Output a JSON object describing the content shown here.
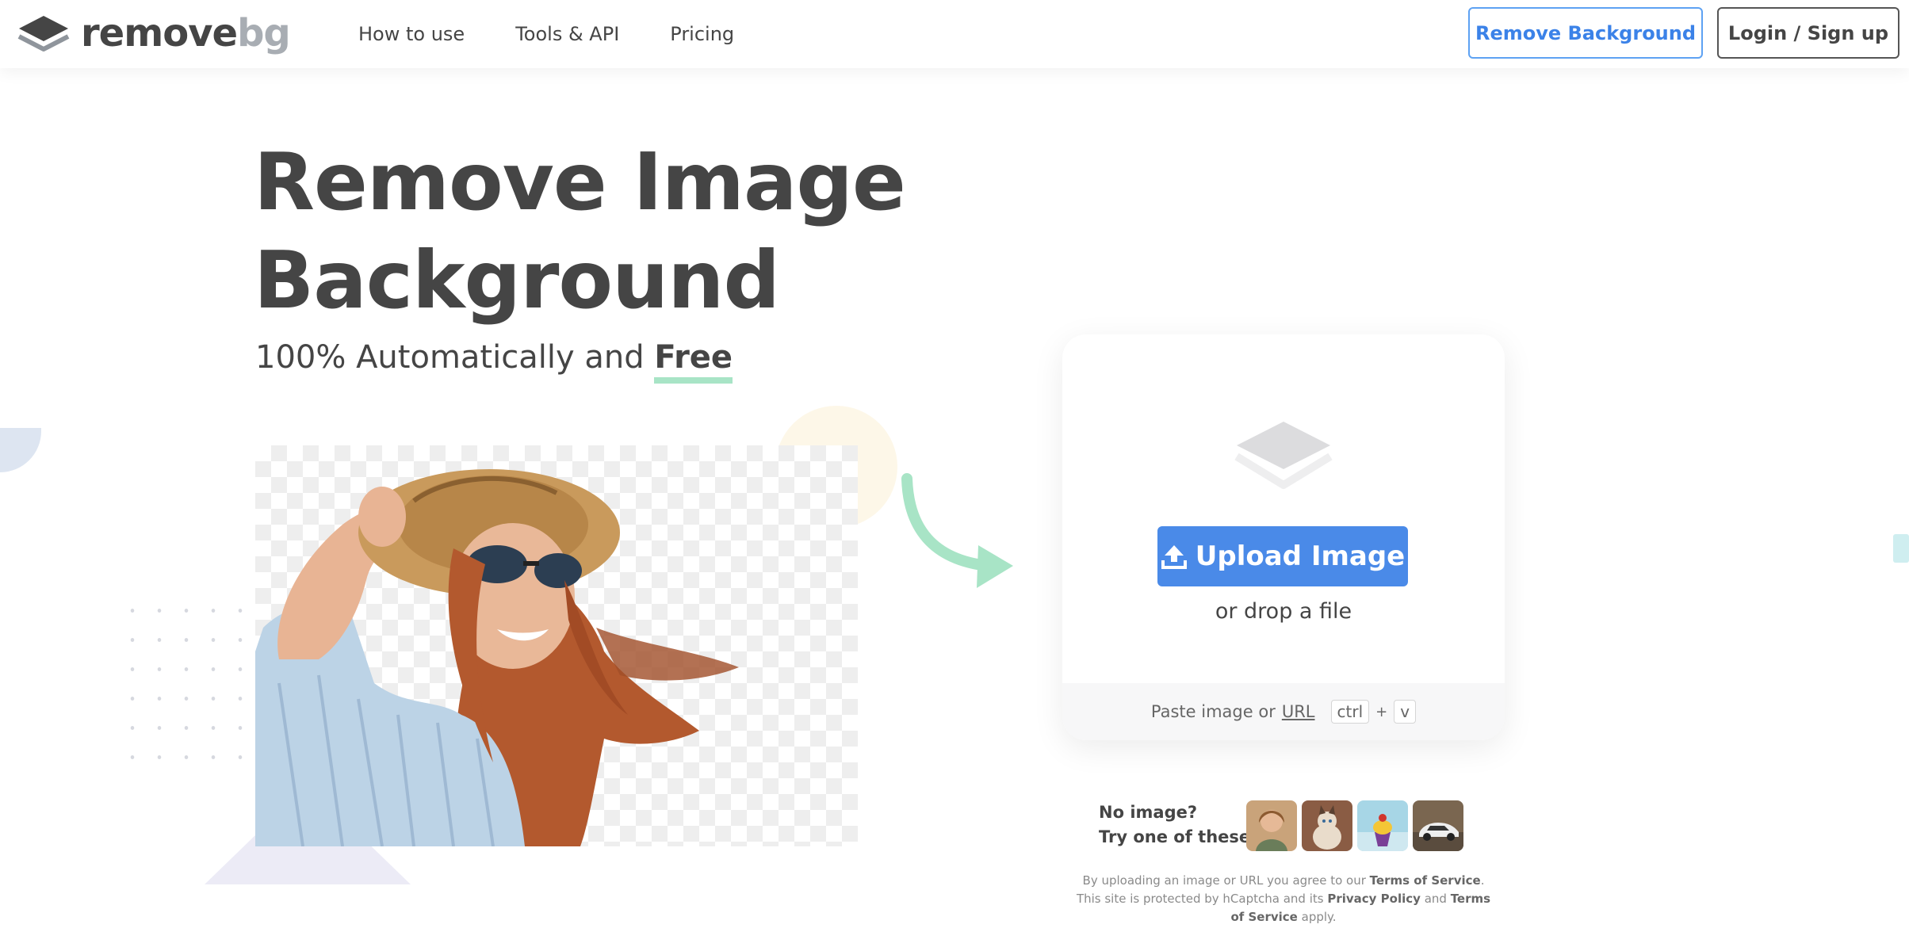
{
  "header": {
    "logo_text_1": "remove",
    "logo_text_2": "bg",
    "nav": [
      "How to use",
      "Tools & API",
      "Pricing"
    ],
    "remove_bg_button": "Remove Background",
    "login_button": "Login / Sign up"
  },
  "hero": {
    "title_line_1": "Remove Image",
    "title_line_2": "Background",
    "subtitle": "100% Automatically and ",
    "subtitle_emphasis": "Free"
  },
  "upload": {
    "button_label": "Upload Image",
    "drop_text": "or drop a file",
    "paste_text": "Paste image or",
    "url_link": "URL",
    "key_ctrl": "ctrl",
    "key_plus": "+",
    "key_v": "v"
  },
  "samples": {
    "line_1": "No image?",
    "line_2": "Try one of these:"
  },
  "legal": {
    "t1": "By uploading an image or URL you agree to our ",
    "terms": "Terms of Service",
    "t2": ". This site is protected by hCaptcha and its ",
    "privacy": "Privacy Policy",
    "t3": " and ",
    "terms2": "Terms of Service",
    "t4": " apply."
  },
  "colors": {
    "primary_blue": "#4a8ae8",
    "text_dark": "#454545",
    "accent_green": "#a8e4c6"
  },
  "icons": [
    "logo-layers-icon",
    "upload-icon",
    "layers-icon",
    "curved-arrow-icon"
  ]
}
